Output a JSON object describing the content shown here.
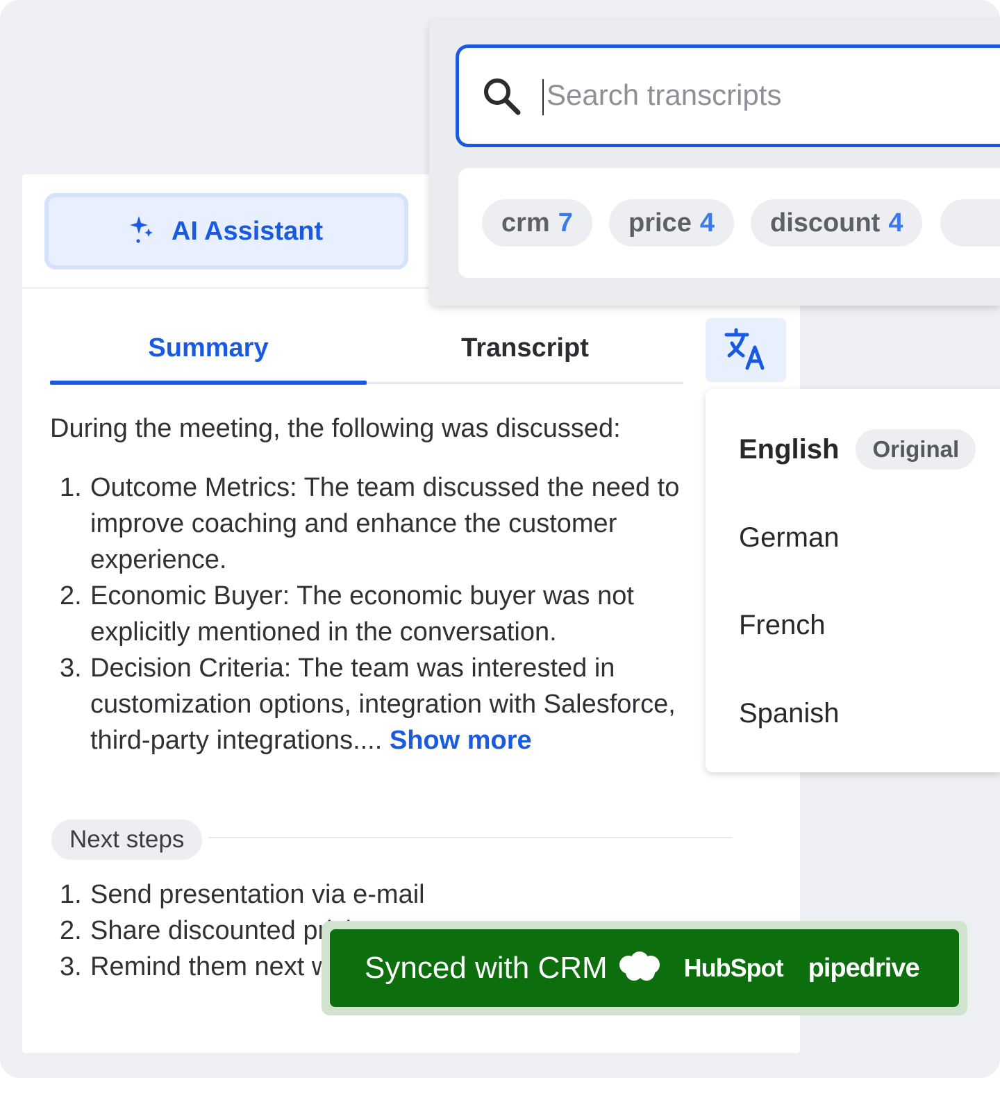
{
  "ai_assistant": {
    "label": "AI Assistant",
    "icon": "sparkle-icon"
  },
  "tabs": [
    {
      "label": "Summary",
      "active": true
    },
    {
      "label": "Transcript",
      "active": false
    }
  ],
  "translate_button": {
    "icon": "translate-icon"
  },
  "summary": {
    "intro": "During the meeting, the following was discussed:",
    "items": [
      {
        "num": "1.",
        "text": "Outcome Metrics: The team discussed the need to improve coaching and enhance the customer experience."
      },
      {
        "num": "2.",
        "text": "Economic Buyer: The economic buyer was not explicitly mentioned in the conversation."
      },
      {
        "num": "3.",
        "text": "Decision Criteria: The team was interested in customization options, integration with Salesforce, third-party integrations...."
      }
    ],
    "show_more": "Show more"
  },
  "next_steps": {
    "label": "Next steps",
    "items": [
      {
        "num": "1.",
        "text": "Send presentation via e-mail"
      },
      {
        "num": "2.",
        "text": "Share discounted pricing"
      },
      {
        "num": "3.",
        "text": "Remind them next week"
      }
    ]
  },
  "search": {
    "placeholder": "Search transcripts",
    "value": ""
  },
  "tags": [
    {
      "label": "crm",
      "count": "7"
    },
    {
      "label": "price",
      "count": "4"
    },
    {
      "label": "discount",
      "count": "4"
    }
  ],
  "languages": {
    "items": [
      {
        "label": "English",
        "badge": "Original"
      },
      {
        "label": "German"
      },
      {
        "label": "French"
      },
      {
        "label": "Spanish"
      }
    ]
  },
  "crm": {
    "text": "Synced with CRM",
    "logos": [
      "Salesforce",
      "HubSpot",
      "pipedrive"
    ],
    "hubspot_label": "HubSpot",
    "pipedrive_label": "pipedrive"
  },
  "colors": {
    "accent": "#1a5ae0",
    "crm_green": "#0c6e0c",
    "background": "#eeeff3"
  }
}
